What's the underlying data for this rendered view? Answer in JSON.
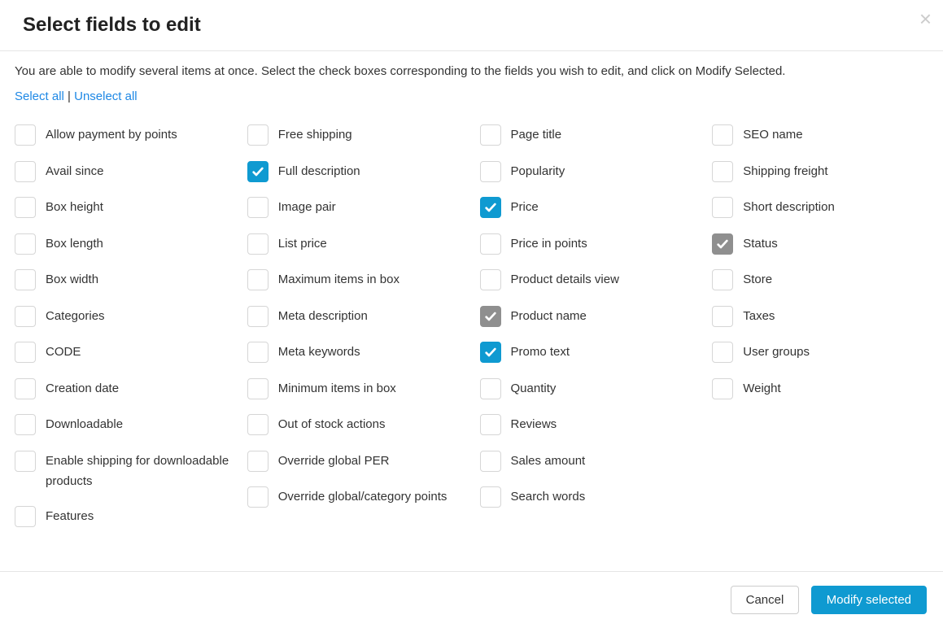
{
  "header": {
    "title": "Select fields to edit"
  },
  "body": {
    "instruction": "You are able to modify several items at once. Select the check boxes corresponding to the fields you wish to edit, and click on Modify Selected.",
    "select_all": "Select all",
    "separator": " | ",
    "unselect_all": "Unselect all"
  },
  "columns": [
    [
      {
        "label": "Allow payment by points",
        "checked": false,
        "disabled": false
      },
      {
        "label": "Avail since",
        "checked": false,
        "disabled": false
      },
      {
        "label": "Box height",
        "checked": false,
        "disabled": false
      },
      {
        "label": "Box length",
        "checked": false,
        "disabled": false
      },
      {
        "label": "Box width",
        "checked": false,
        "disabled": false
      },
      {
        "label": "Categories",
        "checked": false,
        "disabled": false
      },
      {
        "label": "CODE",
        "checked": false,
        "disabled": false
      },
      {
        "label": "Creation date",
        "checked": false,
        "disabled": false
      },
      {
        "label": "Downloadable",
        "checked": false,
        "disabled": false
      },
      {
        "label": "Enable shipping for downloadable products",
        "checked": false,
        "disabled": false
      },
      {
        "label": "Features",
        "checked": false,
        "disabled": false
      }
    ],
    [
      {
        "label": "Free shipping",
        "checked": false,
        "disabled": false
      },
      {
        "label": "Full description",
        "checked": true,
        "disabled": false
      },
      {
        "label": "Image pair",
        "checked": false,
        "disabled": false
      },
      {
        "label": "List price",
        "checked": false,
        "disabled": false
      },
      {
        "label": "Maximum items in box",
        "checked": false,
        "disabled": false
      },
      {
        "label": "Meta description",
        "checked": false,
        "disabled": false
      },
      {
        "label": "Meta keywords",
        "checked": false,
        "disabled": false
      },
      {
        "label": "Minimum items in box",
        "checked": false,
        "disabled": false
      },
      {
        "label": "Out of stock actions",
        "checked": false,
        "disabled": false
      },
      {
        "label": "Override global PER",
        "checked": false,
        "disabled": false
      },
      {
        "label": "Override global/category points",
        "checked": false,
        "disabled": false
      }
    ],
    [
      {
        "label": "Page title",
        "checked": false,
        "disabled": false
      },
      {
        "label": "Popularity",
        "checked": false,
        "disabled": false
      },
      {
        "label": "Price",
        "checked": true,
        "disabled": false
      },
      {
        "label": "Price in points",
        "checked": false,
        "disabled": false
      },
      {
        "label": "Product details view",
        "checked": false,
        "disabled": false
      },
      {
        "label": "Product name",
        "checked": true,
        "disabled": true
      },
      {
        "label": "Promo text",
        "checked": true,
        "disabled": false
      },
      {
        "label": "Quantity",
        "checked": false,
        "disabled": false
      },
      {
        "label": "Reviews",
        "checked": false,
        "disabled": false
      },
      {
        "label": "Sales amount",
        "checked": false,
        "disabled": false
      },
      {
        "label": "Search words",
        "checked": false,
        "disabled": false
      }
    ],
    [
      {
        "label": "SEO name",
        "checked": false,
        "disabled": false
      },
      {
        "label": "Shipping freight",
        "checked": false,
        "disabled": false
      },
      {
        "label": "Short description",
        "checked": false,
        "disabled": false
      },
      {
        "label": "Status",
        "checked": true,
        "disabled": true
      },
      {
        "label": "Store",
        "checked": false,
        "disabled": false
      },
      {
        "label": "Taxes",
        "checked": false,
        "disabled": false
      },
      {
        "label": "User groups",
        "checked": false,
        "disabled": false
      },
      {
        "label": "Weight",
        "checked": false,
        "disabled": false
      }
    ]
  ],
  "footer": {
    "cancel": "Cancel",
    "submit": "Modify selected"
  }
}
